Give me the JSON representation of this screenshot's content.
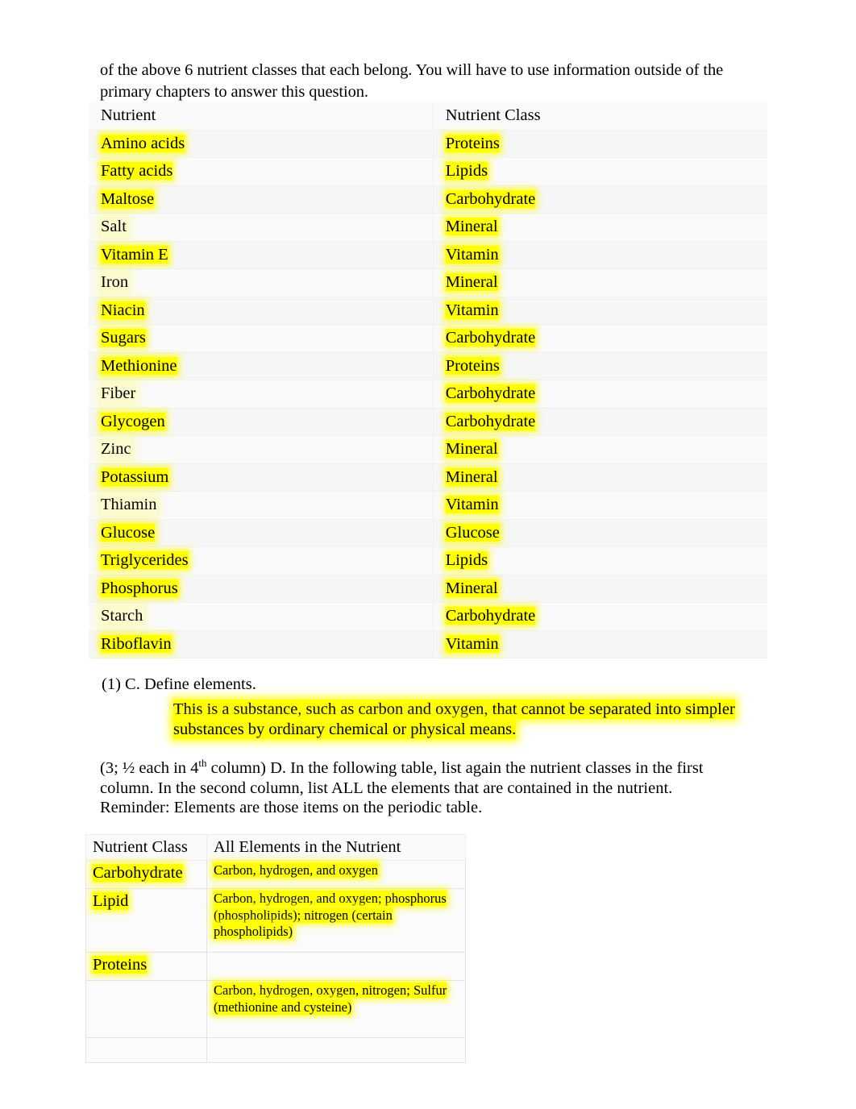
{
  "document": {
    "intro_paragraph": "of the above 6 nutrient classes that each belong. You will have to use information outside of the primary chapters to answer this question."
  },
  "nutrient_table": {
    "headers": [
      "Nutrient",
      "Nutrient Class"
    ],
    "rows": [
      {
        "nutrient": "Amino acids",
        "nutrient_class": "Proteins"
      },
      {
        "nutrient": "Fatty acids",
        "nutrient_class": "Lipids"
      },
      {
        "nutrient": "Maltose",
        "nutrient_class": "Carbohydrate"
      },
      {
        "nutrient": "Salt",
        "nutrient_class": "Mineral"
      },
      {
        "nutrient": "Vitamin E",
        "nutrient_class": "Vitamin"
      },
      {
        "nutrient": "Iron",
        "nutrient_class": "Mineral"
      },
      {
        "nutrient": "Niacin",
        "nutrient_class": "Vitamin"
      },
      {
        "nutrient": "Sugars",
        "nutrient_class": "Carbohydrate"
      },
      {
        "nutrient": "Methionine",
        "nutrient_class": "Proteins"
      },
      {
        "nutrient": "Fiber",
        "nutrient_class": "Carbohydrate"
      },
      {
        "nutrient": "Glycogen",
        "nutrient_class": "Carbohydrate"
      },
      {
        "nutrient": "Zinc",
        "nutrient_class": "Mineral"
      },
      {
        "nutrient": "Potassium",
        "nutrient_class": "Mineral"
      },
      {
        "nutrient": "Thiamin",
        "nutrient_class": "Vitamin"
      },
      {
        "nutrient": "Glucose",
        "nutrient_class": "Glucose"
      },
      {
        "nutrient": "Triglycerides",
        "nutrient_class": "Lipids"
      },
      {
        "nutrient": "Phosphorus",
        "nutrient_class": "Mineral"
      },
      {
        "nutrient": "Starch",
        "nutrient_class": "Carbohydrate"
      },
      {
        "nutrient": "Riboflavin",
        "nutrient_class": "Vitamin"
      }
    ]
  },
  "question_c": {
    "prompt": "(1) C. Define elements.",
    "answer_line1": "This is a substance, such as carbon and oxygen, that cannot be separated into simpler",
    "answer_line2": "substances by ordinary chemical or physical means."
  },
  "question_d": {
    "prefix": "(3; ½ each in 4",
    "superscript": "th",
    "body": " column) D. In the following table, list again the nutrient classes in the first column.  In the second column, list ALL the elements that are contained in the nutrient. Reminder: Elements are those items on the periodic table."
  },
  "elements_table": {
    "headers": [
      "Nutrient Class",
      "All Elements in the Nutrient"
    ],
    "rows": [
      {
        "nutrient_class": "Carbohydrate",
        "elements": "Carbon, hydrogen, and oxygen"
      },
      {
        "nutrient_class": "Lipid",
        "elements": "Carbon, hydrogen, and oxygen; phosphorus (phospholipids); nitrogen (certain phospholipids)"
      },
      {
        "nutrient_class": "Proteins",
        "elements": "Carbon, hydrogen, oxygen, nitrogen; Sulfur (methionine and cysteine)"
      }
    ]
  },
  "colors": {
    "highlight": "#ffff00",
    "text": "#000000",
    "page_background": "#ffffff",
    "table_background": "#fafafa",
    "table_border": "#e3e3e3"
  }
}
